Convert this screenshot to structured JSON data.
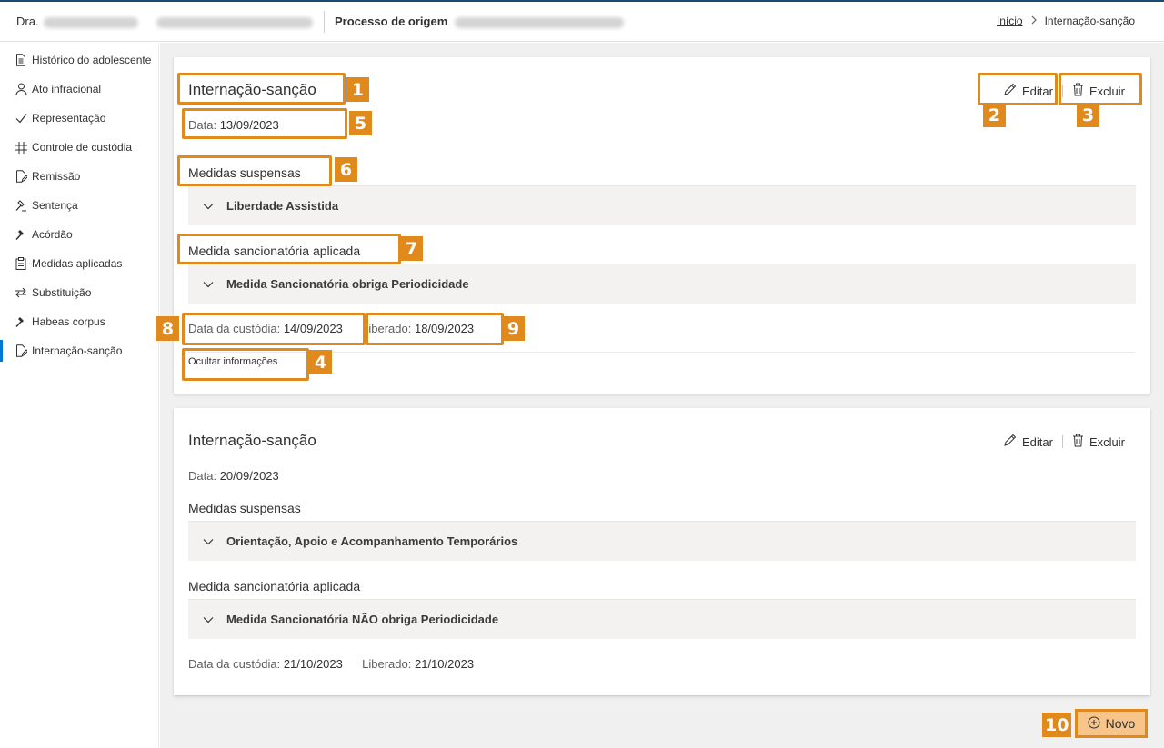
{
  "header": {
    "user_prefix": "Dra.",
    "process_label": "Processo de origem",
    "breadcrumb_home": "Início",
    "breadcrumb_current": "Internação-sanção"
  },
  "sidebar": {
    "items": [
      {
        "label": "Histórico do adolescente",
        "icon": "document-icon"
      },
      {
        "label": "Ato infracional",
        "icon": "person-icon"
      },
      {
        "label": "Representação",
        "icon": "checkmark-icon"
      },
      {
        "label": "Controle de custódia",
        "icon": "grid-icon"
      },
      {
        "label": "Remissão",
        "icon": "document-edit-icon"
      },
      {
        "label": "Sentença",
        "icon": "gavel-icon"
      },
      {
        "label": "Acórdão",
        "icon": "gavel-filled-icon"
      },
      {
        "label": "Medidas aplicadas",
        "icon": "clipboard-icon"
      },
      {
        "label": "Substituição",
        "icon": "swap-icon"
      },
      {
        "label": "Habeas corpus",
        "icon": "gavel-filled-icon"
      },
      {
        "label": "Internação-sanção",
        "icon": "document-edit-icon",
        "active": true
      }
    ]
  },
  "cards": [
    {
      "title": "Internação-sanção",
      "edit_label": "Editar",
      "delete_label": "Excluir",
      "date_label": "Data:",
      "date_value": "13/09/2023",
      "suspended_title": "Medidas suspensas",
      "suspended_item": "Liberdade Assistida",
      "sanction_title": "Medida sancionatória aplicada",
      "sanction_item": "Medida Sancionatória obriga Periodicidade",
      "custody_label": "Data da custódia:",
      "custody_value": "14/09/2023",
      "released_label": "Liberado:",
      "released_value": "18/09/2023",
      "hide_label": "Ocultar informações"
    },
    {
      "title": "Internação-sanção",
      "edit_label": "Editar",
      "delete_label": "Excluir",
      "date_label": "Data:",
      "date_value": "20/09/2023",
      "suspended_title": "Medidas suspensas",
      "suspended_item": "Orientação, Apoio e Acompanhamento Temporários",
      "sanction_title": "Medida sancionatória aplicada",
      "sanction_item": "Medida Sancionatória NÃO obriga Periodicidade",
      "custody_label": "Data da custódia:",
      "custody_value": "21/10/2023",
      "released_label": "Liberado:",
      "released_value": "21/10/2023"
    }
  ],
  "new_button_label": "Novo",
  "annotations": [
    "1",
    "2",
    "3",
    "4",
    "5",
    "6",
    "7",
    "8",
    "9",
    "10"
  ],
  "colors": {
    "annotation": "#e08a1e",
    "accent": "#0078d4",
    "new_button_bg": "#f7c48a"
  }
}
